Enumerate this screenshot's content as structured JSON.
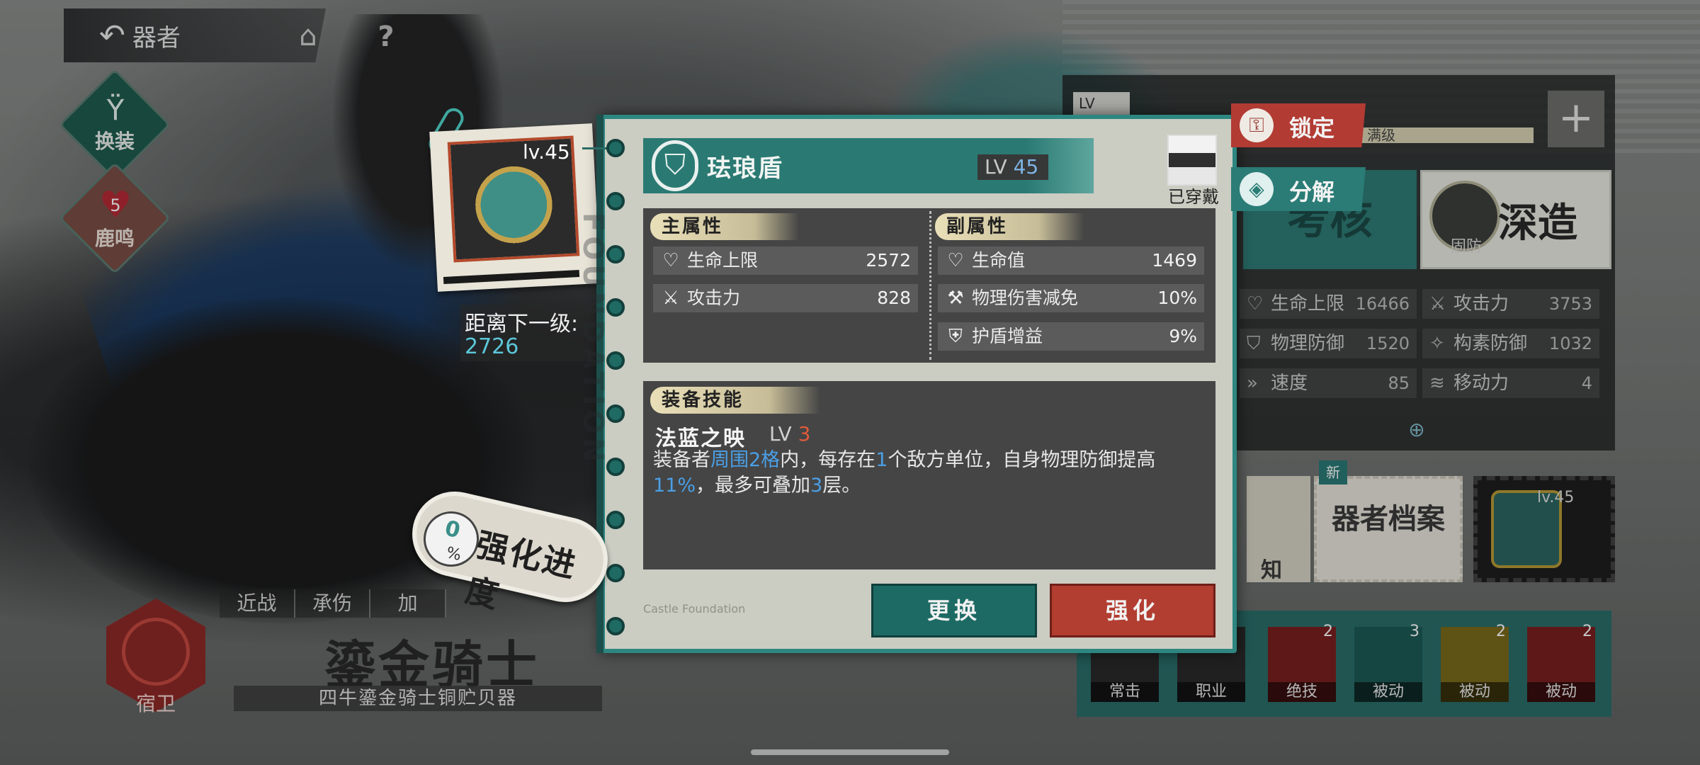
{
  "nav": {
    "back_label": "器者",
    "back_icon": "back-arrow-icon",
    "home_icon": "home-icon",
    "help_icon": "help-icon",
    "help_label": "?"
  },
  "side_menu": {
    "equip_label": "换装",
    "deer_label": "鹿鸣",
    "deer_count": "5"
  },
  "character": {
    "class_tabs": [
      "近战",
      "承伤",
      "加"
    ],
    "role": "宿卫",
    "name": "鎏金骑士",
    "subtitle": "四牛鎏金骑士铜贮贝器"
  },
  "right_bg": {
    "lv_tag": "LV",
    "lv_bar_text": "满级",
    "plus": "+",
    "exam_label": "考核",
    "deep_label": "深造",
    "deep_sub": "固防",
    "stats": [
      {
        "label": "生命上限",
        "value": "16466",
        "icon": "heart-shield-icon"
      },
      {
        "label": "攻击力",
        "value": "3753",
        "icon": "crossed-swords-icon"
      },
      {
        "label": "物理防御",
        "value": "1520",
        "icon": "shield-icon"
      },
      {
        "label": "构素防御",
        "value": "1032",
        "icon": "magic-shield-icon"
      },
      {
        "label": "速度",
        "value": "85",
        "icon": "speed-icon"
      },
      {
        "label": "移动力",
        "value": "4",
        "icon": "move-icon"
      }
    ],
    "archive_label": "器者档案",
    "archive_new": "新",
    "partial_text": "知",
    "stamp_lv": "lv.45",
    "skills": [
      {
        "label": "常击",
        "count": ""
      },
      {
        "label": "职业",
        "count": ""
      },
      {
        "label": "绝技",
        "count": "2"
      },
      {
        "label": "被动",
        "count": "3"
      },
      {
        "label": "被动",
        "count": "2"
      },
      {
        "label": "被动",
        "count": "2"
      }
    ]
  },
  "equipment_card": {
    "lv_text": "lv.45"
  },
  "next_level": {
    "label": "距离下一级:",
    "value": "2726"
  },
  "progress": {
    "value": "0",
    "unit": "%",
    "label": "强化进度"
  },
  "modal": {
    "spine_text": "FOUNDATION",
    "name": "珐琅盾",
    "lv_prefix": "LV",
    "lv_value": "45",
    "equipped_label": "已穿戴",
    "main_attr_title": "主属性",
    "main_attrs": [
      {
        "label": "生命上限",
        "value": "2572",
        "icon": "heart-shield-icon"
      },
      {
        "label": "攻击力",
        "value": "828",
        "icon": "crossed-swords-icon"
      }
    ],
    "sub_attr_title": "副属性",
    "sub_attrs": [
      {
        "label": "生命值",
        "value": "1469",
        "icon": "heart-shield-icon"
      },
      {
        "label": "物理伤害减免",
        "value": "10%",
        "icon": "sword-break-icon"
      },
      {
        "label": "护盾增益",
        "value": "9%",
        "icon": "shield-plus-icon"
      }
    ],
    "skill_title": "装备技能",
    "skill_name": "法蓝之映",
    "skill_lv_prefix": "LV",
    "skill_lv_value": "3",
    "skill_desc": {
      "p1": "装备者",
      "h1": "周围2格",
      "p2": "内，每存在",
      "h2": "1",
      "p3": "个敌方单位，自身物理防御提高",
      "h3": "11%",
      "p4": "，最多可叠加",
      "h4": "3",
      "p5": "层。"
    },
    "footer_stamps": "Castle Foundation",
    "replace_label": "更换",
    "enhance_label": "强化"
  },
  "actions": {
    "lock_label": "锁定",
    "dismantle_label": "分解"
  },
  "colors": {
    "teal": "#2a7a73",
    "red": "#b23d31",
    "highlight_blue": "#4a9fe6",
    "lv_orange": "#e05a3a"
  }
}
